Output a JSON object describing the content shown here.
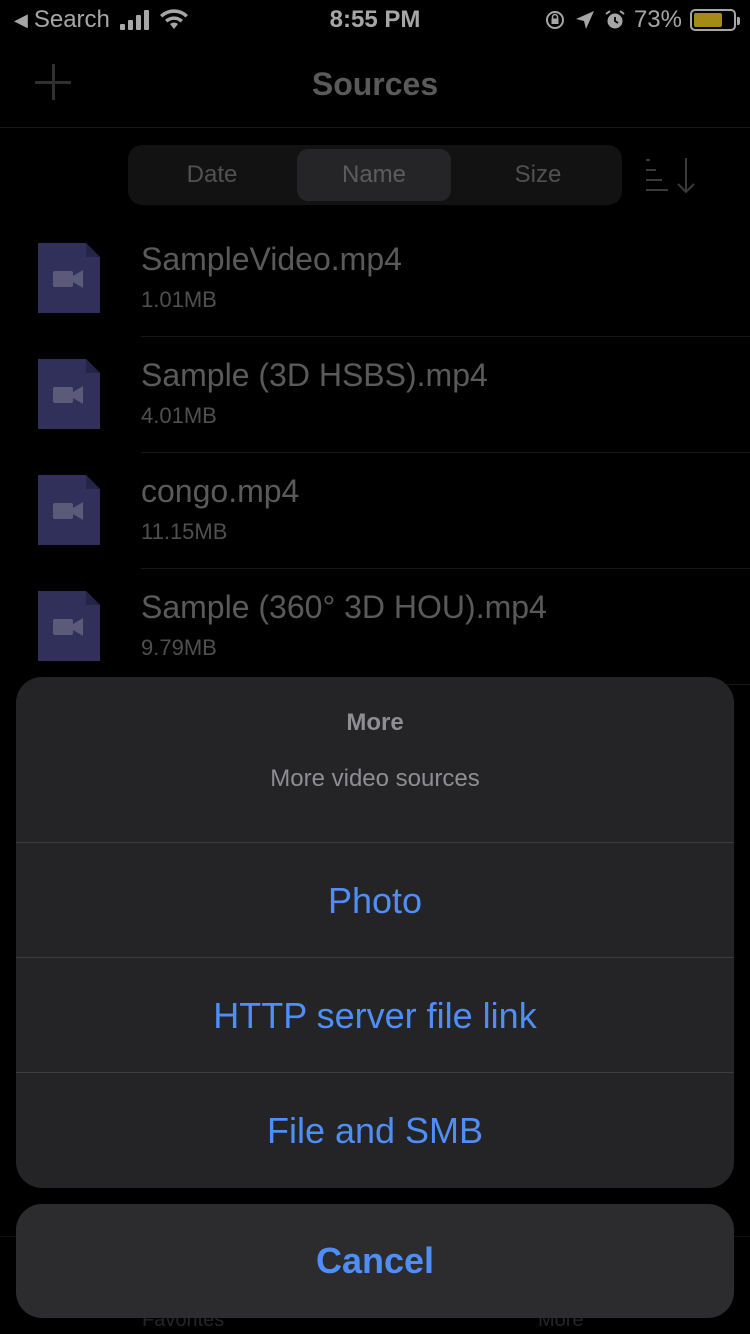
{
  "status_bar": {
    "back_app": "Search",
    "time": "8:55 PM",
    "battery_percent": "73%",
    "battery_level": 0.73,
    "battery_color": "#ffd426"
  },
  "nav": {
    "title": "Sources",
    "add_icon": "plus-icon"
  },
  "sort": {
    "options": [
      "Date",
      "Name",
      "Size"
    ],
    "selected": "Name",
    "direction_icon": "sort-descending-icon"
  },
  "files": [
    {
      "name": "SampleVideo.mp4",
      "size": "1.01MB"
    },
    {
      "name": "Sample (3D HSBS).mp4",
      "size": "4.01MB"
    },
    {
      "name": "congo.mp4",
      "size": "11.15MB"
    },
    {
      "name": "Sample (360° 3D HOU).mp4",
      "size": "9.79MB"
    }
  ],
  "file_icon_color": "#4b4a8a",
  "tab_bar": {
    "left_label": "Favorites",
    "right_label": "More"
  },
  "action_sheet": {
    "title": "More",
    "message": "More video sources",
    "actions": [
      "Photo",
      "HTTP server file link",
      "File and SMB"
    ],
    "cancel": "Cancel",
    "accent_color": "#4f8ef7"
  }
}
